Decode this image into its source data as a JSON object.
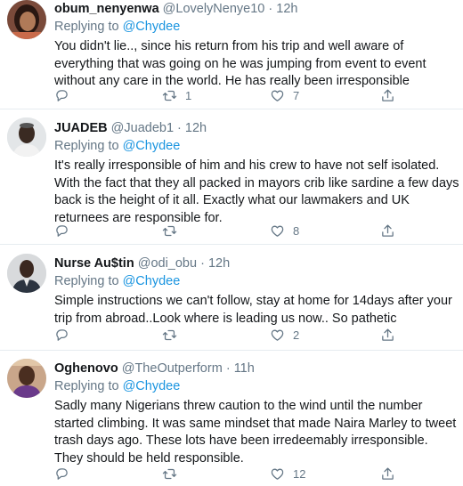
{
  "tweets": [
    {
      "name": "obum_nenyenwa",
      "handle": "@LovelyNenye10",
      "time": "12h",
      "replying_prefix": "Replying to",
      "replying_to": "@Chydee",
      "text": "You didn't lie.., since his return from his trip and well aware of everything that was going on he was jumping from event to event without any care in the world. He has really been irresponsible",
      "replies": "",
      "retweets": "1",
      "likes": "7"
    },
    {
      "name": "JUADEB",
      "handle": "@Juadeb1",
      "time": "12h",
      "replying_prefix": "Replying to",
      "replying_to": "@Chydee",
      "text": "It's really irresponsible of him and his crew to have not self isolated. With the fact that they all packed in mayors crib like sardine a few days back is the height of it all. Exactly what our lawmakers and UK returnees are responsible for.",
      "replies": "",
      "retweets": "",
      "likes": "8"
    },
    {
      "name": "Nurse Au$tin",
      "handle": "@odi_obu",
      "time": "12h",
      "replying_prefix": "Replying to",
      "replying_to": "@Chydee",
      "text": "Simple instructions we can't follow, stay at home for 14days after your trip from abroad..Look where is leading us now.. So pathetic",
      "replies": "",
      "retweets": "",
      "likes": "2"
    },
    {
      "name": "Oghenovo",
      "handle": "@TheOutperform",
      "time": "11h",
      "replying_prefix": "Replying to",
      "replying_to": "@Chydee",
      "text": "Sadly many Nigerians threw caution to the wind until the number started climbing. It was same mindset that made Naira Marley to tweet trash days ago. These lots have been irredeemably irresponsible. They should be held responsible.",
      "replies": "",
      "retweets": "",
      "likes": "12"
    }
  ],
  "separator": "·",
  "icons": {
    "reply": "reply-icon",
    "retweet": "retweet-icon",
    "like": "heart-icon",
    "share": "share-icon"
  },
  "colors": {
    "link": "#1b95e0",
    "muted": "#657786",
    "text": "#14171a",
    "divider": "#e6ecf0"
  }
}
